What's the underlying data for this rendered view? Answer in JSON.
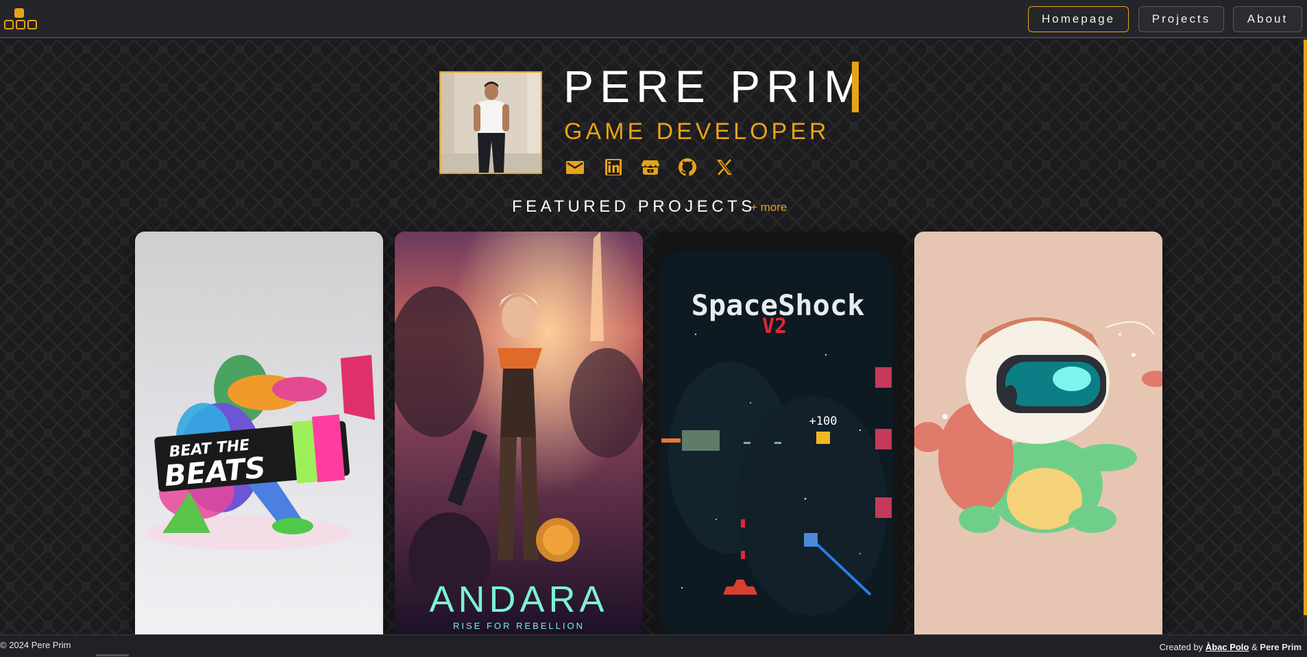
{
  "nav": {
    "items": [
      {
        "label": "Homepage",
        "active": true
      },
      {
        "label": "Projects",
        "active": false
      },
      {
        "label": "About",
        "active": false
      }
    ]
  },
  "hero": {
    "name": "PERE PRIM",
    "role": "GAME DEVELOPER",
    "socials": [
      "mail-icon",
      "linkedin-icon",
      "itchio-icon",
      "github-icon",
      "x-icon"
    ]
  },
  "featured": {
    "title": "FEATURED PROJECTS",
    "more_label": "+ more",
    "projects": [
      {
        "title_line1": "BEAT THE",
        "title_line2": "BEATS"
      },
      {
        "title": "ANDARA",
        "subtitle": "RISE FOR REBELLION"
      },
      {
        "title": "SpaceShock",
        "version": "V2",
        "score": "+100"
      },
      {
        "title": ""
      }
    ]
  },
  "footer": {
    "copyright": "© 2024 Pere Prim",
    "created_by": "Created by",
    "author1": "Àbac Polo",
    "amp": "&",
    "author2": "Pere Prim"
  },
  "colors": {
    "accent": "#e8a21a",
    "background": "#1c1c1e",
    "nav_bg": "#24252b"
  }
}
